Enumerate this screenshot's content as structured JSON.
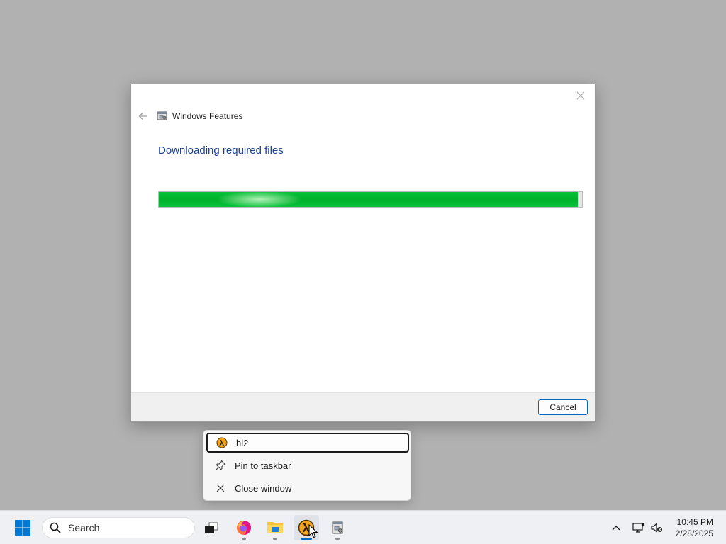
{
  "dialog": {
    "title": "Windows Features",
    "heading": "Downloading required files",
    "progress_percent": 99,
    "cancel_label": "Cancel",
    "progress_color": "#00b12a",
    "heading_color": "#1c3f95"
  },
  "jumplist": {
    "items": [
      {
        "label": "hl2",
        "icon": "half-life-icon",
        "selected": true
      },
      {
        "label": "Pin to taskbar",
        "icon": "pin-icon",
        "selected": false
      },
      {
        "label": "Close window",
        "icon": "close-icon",
        "selected": false
      }
    ]
  },
  "taskbar": {
    "search_placeholder": "Search",
    "apps": [
      {
        "name": "task-view",
        "icon": "task-view-icon",
        "running": false
      },
      {
        "name": "firefox",
        "icon": "firefox-icon",
        "running": true
      },
      {
        "name": "file-explorer",
        "icon": "folder-icon",
        "running": true
      },
      {
        "name": "hl2",
        "icon": "half-life-icon",
        "running": true,
        "active": true
      },
      {
        "name": "windows-features",
        "icon": "windows-features-icon",
        "running": true
      }
    ],
    "clock": {
      "time": "10:45 PM",
      "date": "2/28/2025"
    },
    "accent_color": "#0067c0"
  }
}
